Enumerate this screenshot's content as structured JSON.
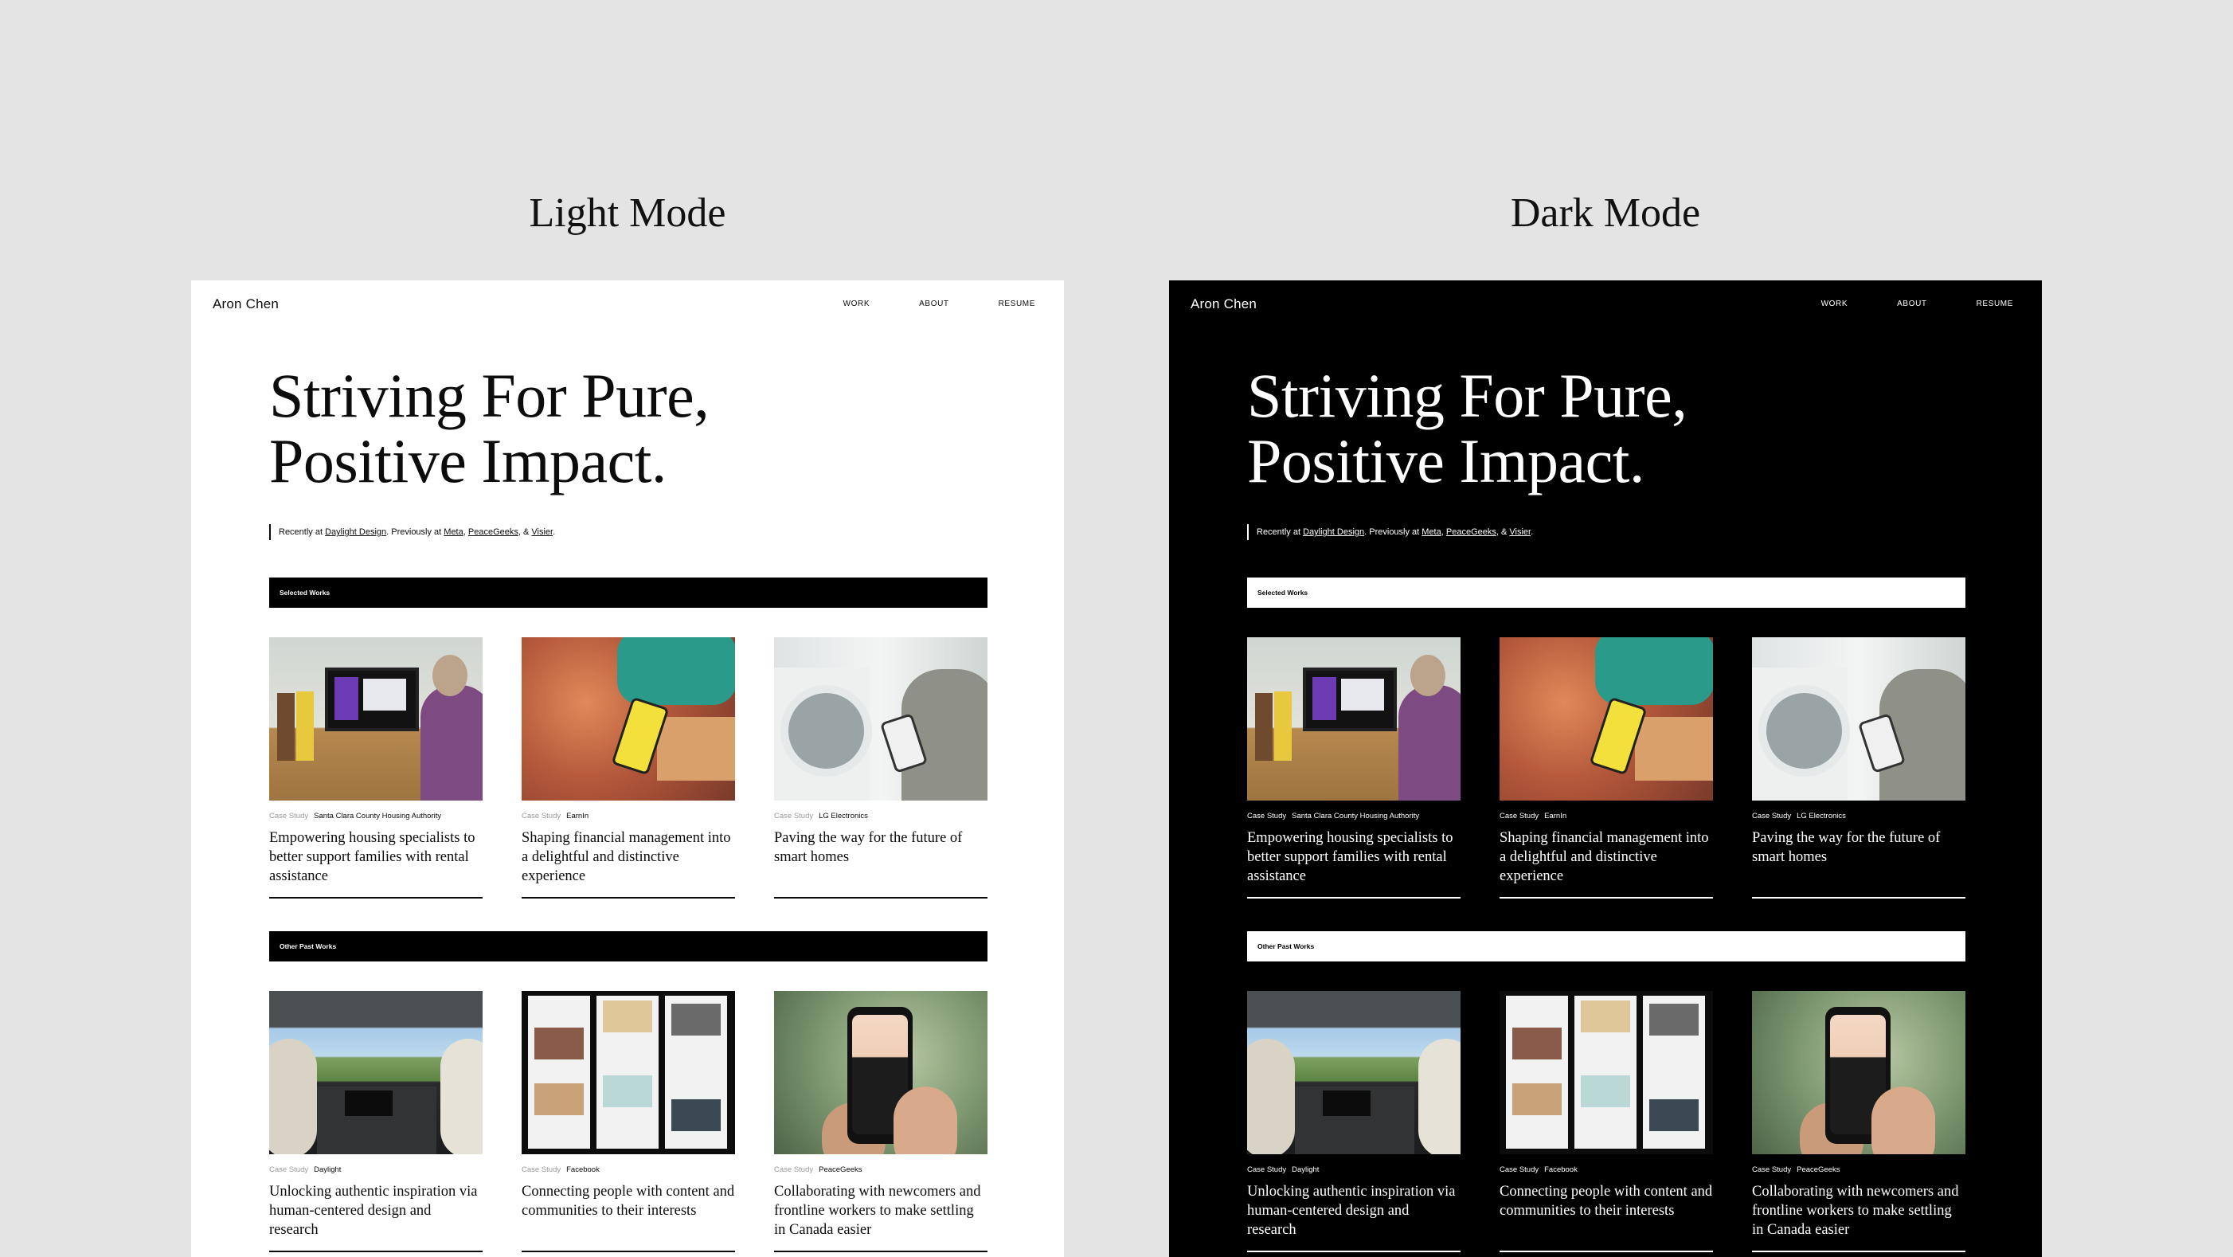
{
  "labels": {
    "light": "Light Mode",
    "dark": "Dark Mode"
  },
  "site": {
    "brand": "Aron Chen",
    "nav": [
      "WORK",
      "ABOUT",
      "RESUME"
    ],
    "hero_line1": "Striving For Pure,",
    "hero_line2": "Positive Impact.",
    "tagline": {
      "prefix": "Recently at ",
      "recent": "Daylight Design",
      "middle": ". Previously at ",
      "prev1": "Meta",
      "sep1": ", ",
      "prev2": "PeaceGeeks",
      "sep2": ", & ",
      "prev3": "Visier",
      "end": "."
    },
    "sections": {
      "selected": "Selected Works",
      "other": "Other Past Works"
    },
    "case_label": "Case Study",
    "selected": [
      {
        "client": "Santa Clara County Housing Authority",
        "title": "Empowering housing specialists to better support families with rental assistance"
      },
      {
        "client": "EarnIn",
        "title": "Shaping financial management into a delightful and distinctive experience"
      },
      {
        "client": "LG Electronics",
        "title": "Paving the way for the future of smart homes"
      }
    ],
    "other": [
      {
        "client": "Daylight",
        "title": "Unlocking authentic inspiration via human-centered design and research"
      },
      {
        "client": "Facebook",
        "title": "Connecting people with content and communities to their interests"
      },
      {
        "client": "PeaceGeeks",
        "title": "Collaborating with newcomers and frontline workers to make settling in Canada easier"
      }
    ]
  },
  "colors": {
    "canvas": "#e4e4e4",
    "light_bg": "#ffffff",
    "dark_bg": "#000000"
  }
}
